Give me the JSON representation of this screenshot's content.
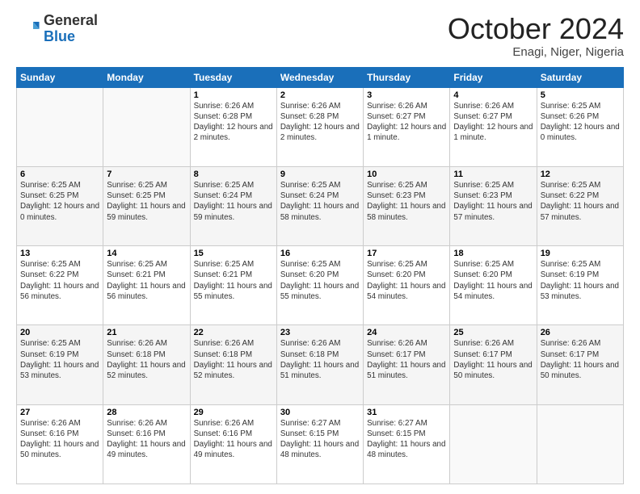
{
  "logo": {
    "general": "General",
    "blue": "Blue"
  },
  "header": {
    "month": "October 2024",
    "location": "Enagi, Niger, Nigeria"
  },
  "weekdays": [
    "Sunday",
    "Monday",
    "Tuesday",
    "Wednesday",
    "Thursday",
    "Friday",
    "Saturday"
  ],
  "weeks": [
    [
      {
        "day": "",
        "info": ""
      },
      {
        "day": "",
        "info": ""
      },
      {
        "day": "1",
        "info": "Sunrise: 6:26 AM\nSunset: 6:28 PM\nDaylight: 12 hours and 2 minutes."
      },
      {
        "day": "2",
        "info": "Sunrise: 6:26 AM\nSunset: 6:28 PM\nDaylight: 12 hours and 2 minutes."
      },
      {
        "day": "3",
        "info": "Sunrise: 6:26 AM\nSunset: 6:27 PM\nDaylight: 12 hours and 1 minute."
      },
      {
        "day": "4",
        "info": "Sunrise: 6:26 AM\nSunset: 6:27 PM\nDaylight: 12 hours and 1 minute."
      },
      {
        "day": "5",
        "info": "Sunrise: 6:25 AM\nSunset: 6:26 PM\nDaylight: 12 hours and 0 minutes."
      }
    ],
    [
      {
        "day": "6",
        "info": "Sunrise: 6:25 AM\nSunset: 6:25 PM\nDaylight: 12 hours and 0 minutes."
      },
      {
        "day": "7",
        "info": "Sunrise: 6:25 AM\nSunset: 6:25 PM\nDaylight: 11 hours and 59 minutes."
      },
      {
        "day": "8",
        "info": "Sunrise: 6:25 AM\nSunset: 6:24 PM\nDaylight: 11 hours and 59 minutes."
      },
      {
        "day": "9",
        "info": "Sunrise: 6:25 AM\nSunset: 6:24 PM\nDaylight: 11 hours and 58 minutes."
      },
      {
        "day": "10",
        "info": "Sunrise: 6:25 AM\nSunset: 6:23 PM\nDaylight: 11 hours and 58 minutes."
      },
      {
        "day": "11",
        "info": "Sunrise: 6:25 AM\nSunset: 6:23 PM\nDaylight: 11 hours and 57 minutes."
      },
      {
        "day": "12",
        "info": "Sunrise: 6:25 AM\nSunset: 6:22 PM\nDaylight: 11 hours and 57 minutes."
      }
    ],
    [
      {
        "day": "13",
        "info": "Sunrise: 6:25 AM\nSunset: 6:22 PM\nDaylight: 11 hours and 56 minutes."
      },
      {
        "day": "14",
        "info": "Sunrise: 6:25 AM\nSunset: 6:21 PM\nDaylight: 11 hours and 56 minutes."
      },
      {
        "day": "15",
        "info": "Sunrise: 6:25 AM\nSunset: 6:21 PM\nDaylight: 11 hours and 55 minutes."
      },
      {
        "day": "16",
        "info": "Sunrise: 6:25 AM\nSunset: 6:20 PM\nDaylight: 11 hours and 55 minutes."
      },
      {
        "day": "17",
        "info": "Sunrise: 6:25 AM\nSunset: 6:20 PM\nDaylight: 11 hours and 54 minutes."
      },
      {
        "day": "18",
        "info": "Sunrise: 6:25 AM\nSunset: 6:20 PM\nDaylight: 11 hours and 54 minutes."
      },
      {
        "day": "19",
        "info": "Sunrise: 6:25 AM\nSunset: 6:19 PM\nDaylight: 11 hours and 53 minutes."
      }
    ],
    [
      {
        "day": "20",
        "info": "Sunrise: 6:25 AM\nSunset: 6:19 PM\nDaylight: 11 hours and 53 minutes."
      },
      {
        "day": "21",
        "info": "Sunrise: 6:26 AM\nSunset: 6:18 PM\nDaylight: 11 hours and 52 minutes."
      },
      {
        "day": "22",
        "info": "Sunrise: 6:26 AM\nSunset: 6:18 PM\nDaylight: 11 hours and 52 minutes."
      },
      {
        "day": "23",
        "info": "Sunrise: 6:26 AM\nSunset: 6:18 PM\nDaylight: 11 hours and 51 minutes."
      },
      {
        "day": "24",
        "info": "Sunrise: 6:26 AM\nSunset: 6:17 PM\nDaylight: 11 hours and 51 minutes."
      },
      {
        "day": "25",
        "info": "Sunrise: 6:26 AM\nSunset: 6:17 PM\nDaylight: 11 hours and 50 minutes."
      },
      {
        "day": "26",
        "info": "Sunrise: 6:26 AM\nSunset: 6:17 PM\nDaylight: 11 hours and 50 minutes."
      }
    ],
    [
      {
        "day": "27",
        "info": "Sunrise: 6:26 AM\nSunset: 6:16 PM\nDaylight: 11 hours and 50 minutes."
      },
      {
        "day": "28",
        "info": "Sunrise: 6:26 AM\nSunset: 6:16 PM\nDaylight: 11 hours and 49 minutes."
      },
      {
        "day": "29",
        "info": "Sunrise: 6:26 AM\nSunset: 6:16 PM\nDaylight: 11 hours and 49 minutes."
      },
      {
        "day": "30",
        "info": "Sunrise: 6:27 AM\nSunset: 6:15 PM\nDaylight: 11 hours and 48 minutes."
      },
      {
        "day": "31",
        "info": "Sunrise: 6:27 AM\nSunset: 6:15 PM\nDaylight: 11 hours and 48 minutes."
      },
      {
        "day": "",
        "info": ""
      },
      {
        "day": "",
        "info": ""
      }
    ]
  ]
}
